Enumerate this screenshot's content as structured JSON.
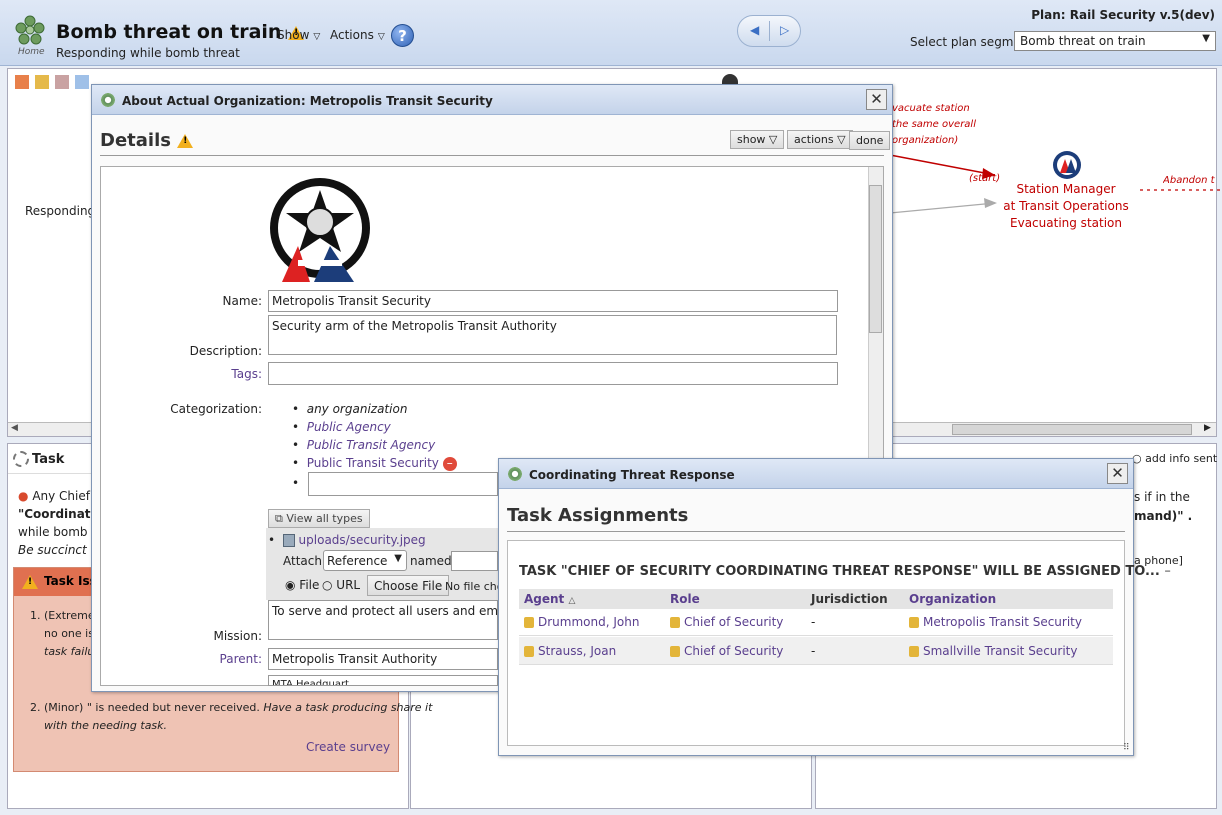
{
  "header": {
    "title": "Bomb threat on train",
    "subtitle": "Responding while bomb threat",
    "home_label": "Home",
    "show_label": "Show",
    "actions_label": "Actions",
    "help_label": "?",
    "plan_label": "Plan: Rail Security v.5(dev)",
    "segment_label": "Select plan segment:",
    "segment_value": "Bomb threat on train"
  },
  "flow": {
    "left_label": "Responding",
    "note_line1": "vacuate station",
    "note_line2": "the same overall",
    "note_line3": "organization)",
    "start_label": "(start)",
    "node_line1": "Station Manager",
    "node_line2": "at Transit Operations",
    "node_line3": "Evacuating station",
    "abandon_label": "Abandon tr"
  },
  "task": {
    "title": "Task",
    "text_prefix": "Any Chief",
    "quoted": "\"Coordinatin",
    "line3": "while bomb th",
    "line4": "Be succinct",
    "issues_title": "Task Iss",
    "issue1_a": "1.  (Extreme",
    "issue1_b": "no one is",
    "issue1_c": "task failur",
    "issue2_a": "2.  (Minor) \" is needed but never received.",
    "issue2_b": "Have a task producing share it",
    "issue2_c": "with the needing task.",
    "create_survey": "Create survey"
  },
  "right_pane": {
    "add_info": "add info sent",
    "line1": "s if in the",
    "line2": "mand)\" .",
    "line3": "a phone]"
  },
  "org_dialog": {
    "title": "About Actual Organization: Metropolis Transit Security",
    "details": "Details",
    "show_btn": "show",
    "actions_btn": "actions",
    "done_btn": "done",
    "name_label": "Name:",
    "name_value": "Metropolis Transit Security",
    "desc_label": "Description:",
    "desc_value": "Security arm of the Metropolis Transit Authority",
    "tags_label": "Tags:",
    "tags_value": "",
    "cat_label": "Categorization:",
    "categories": [
      "any organization",
      "Public Agency",
      "Public Transit Agency",
      "Public Transit Security"
    ],
    "view_all": "View all types",
    "upload_file": "uploads/security.jpeg",
    "attach_label": "Attach:",
    "attach_value": "Reference",
    "named_label": "named",
    "file_label": "File",
    "url_label": "URL",
    "choose_file": "Choose File",
    "no_file": "No file cho",
    "mission_label": "Mission:",
    "mission_value": "To serve and protect all users and employ",
    "parent_label": "Parent:",
    "parent_value": "Metropolis Transit Authority",
    "location_value": "MTA Headquart"
  },
  "task_dialog": {
    "title": "Coordinating Threat Response",
    "heading": "Task Assignments",
    "banner": "TASK \"CHIEF OF SECURITY COORDINATING THREAT RESPONSE\" WILL BE ASSIGNED TO...",
    "columns": [
      "Agent",
      "Role",
      "Jurisdiction",
      "Organization"
    ],
    "rows": [
      {
        "agent": "Drummond, John",
        "role": "Chief of Security",
        "jurisdiction": "-",
        "org": "Metropolis Transit Security"
      },
      {
        "agent": "Strauss, Joan",
        "role": "Chief of Security",
        "jurisdiction": "-",
        "org": "Smallville Transit Security"
      }
    ]
  },
  "colors": {
    "accent": "#5a3f8e",
    "issue_bg": "#efc3b4",
    "issue_hdr": "#e07050",
    "flow_red": "#c00000"
  }
}
